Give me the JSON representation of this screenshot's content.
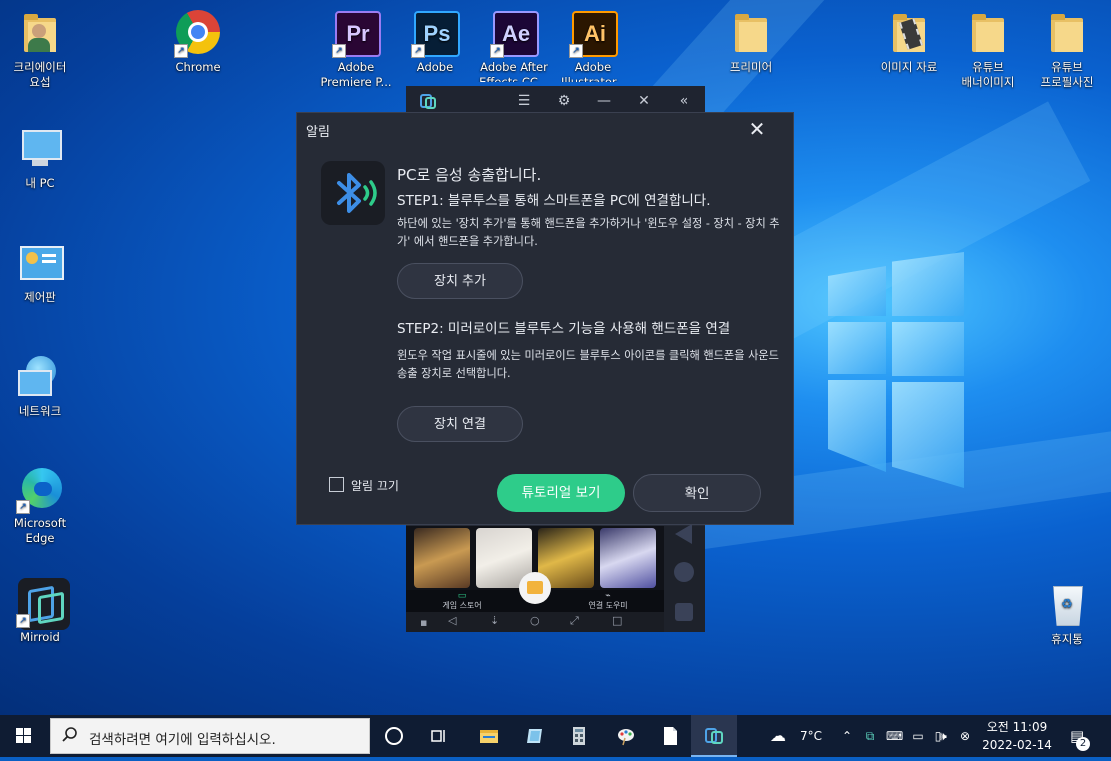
{
  "desktop": {
    "icons_left": [
      {
        "label": "크리에이터\n요섭"
      },
      {
        "label": "내 PC"
      },
      {
        "label": "제어판"
      },
      {
        "label": "네트워크"
      },
      {
        "label": "Microsoft Edge"
      },
      {
        "label": "Mirroid"
      }
    ],
    "icons_top": [
      {
        "label": "Chrome"
      },
      {
        "label": "Adobe Premiere P...",
        "glyph": "Pr"
      },
      {
        "label": "Adobe Photosho...",
        "glyph": "Ps"
      },
      {
        "label": "Adobe After Effects CC...",
        "glyph": "Ae"
      },
      {
        "label": "Adobe Illustrator...",
        "glyph": "Ai"
      },
      {
        "label": "프리미어"
      },
      {
        "label": "이미지 자료"
      },
      {
        "label": "유튜브\n배너이미지"
      },
      {
        "label": "유튜브\n프로필사진"
      }
    ],
    "recycle_bin": {
      "label": "휴지통"
    }
  },
  "phone_window": {
    "tab_game_store": "게임 스토어",
    "tab_connect_assist": "연결 도우미"
  },
  "dialog": {
    "title": "알림",
    "heading": "PC로 음성 송출합니다.",
    "step1_title": "STEP1: 블루투스를 통해 스마트폰을 PC에 연결합니다.",
    "step1_desc": "하단에 있는 '장치 추가'를 통해 핸드폰을 추가하거나 '윈도우 설정 - 장치 - 장치 추가' 에서 핸드폰을 추가합니다.",
    "add_device_button": "장치 추가",
    "step2_title": "STEP2: 미러로이드 블루투스 기능을 사용해 핸드폰을 연결",
    "step2_desc": "윈도우 작업 표시줄에 있는 미러로이드 블루투스 아이콘를 클릭해 핸드폰을 사운드 송출 장치로 선택합니다.",
    "connect_device_button": "장치 연결",
    "mute_label": "알림 끄기",
    "tutorial_button": "튜토리얼 보기",
    "ok_button": "확인"
  },
  "taskbar": {
    "search_placeholder": "검색하려면 여기에 입력하십시오.",
    "weather": "7°C",
    "time": "오전 11:09",
    "date": "2022-02-14",
    "notification_count": "2"
  },
  "colors": {
    "dialog_bg": "#262b36",
    "accent_green": "#2ecc8a",
    "taskbar_bg": "#0f1c33"
  }
}
